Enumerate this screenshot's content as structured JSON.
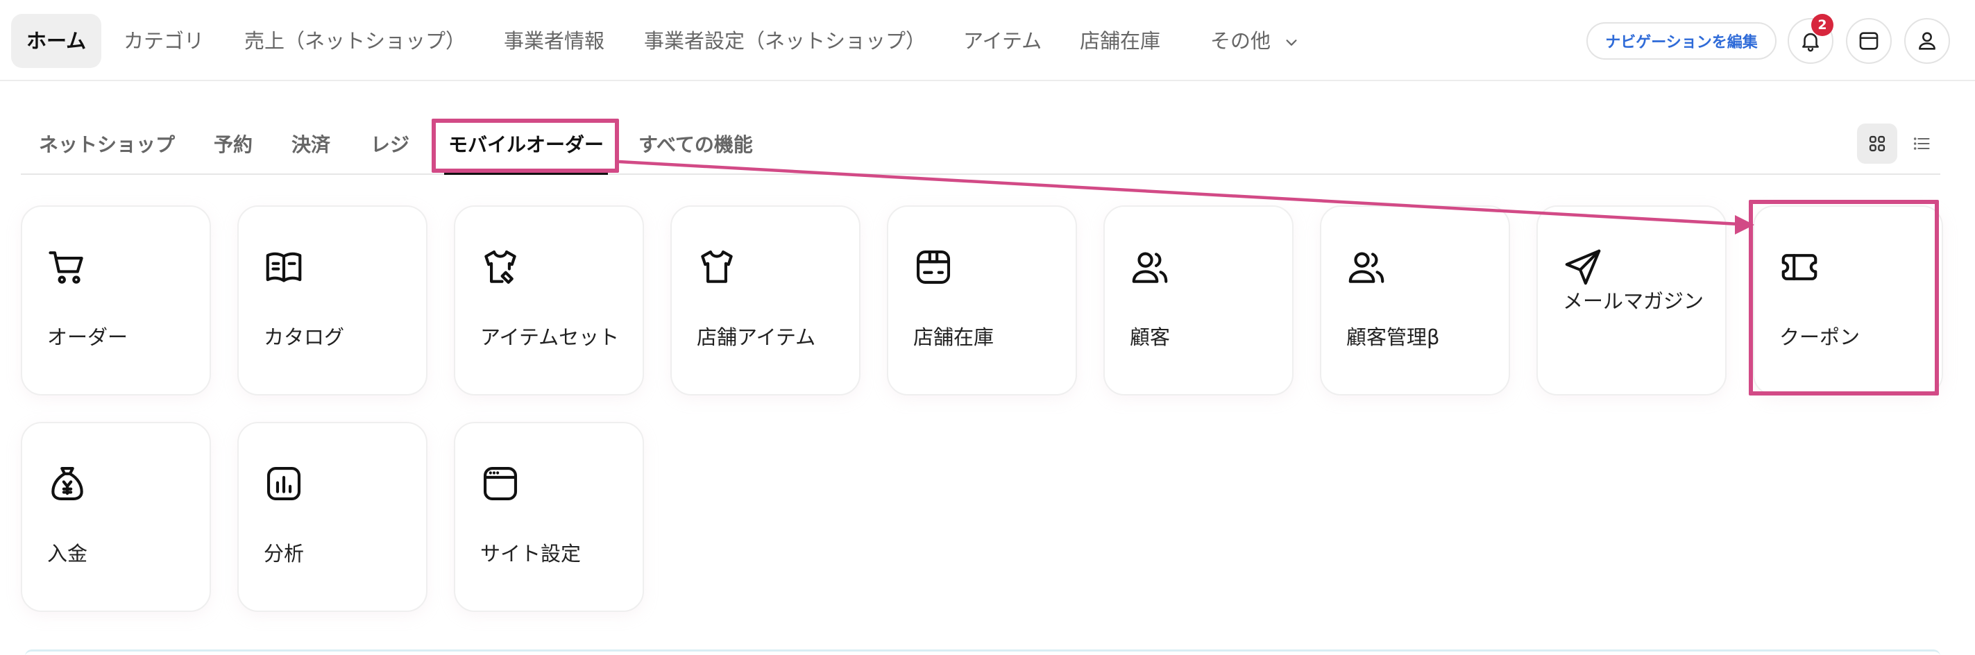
{
  "top_nav": {
    "items": [
      "ホーム",
      "カテゴリ",
      "売上（ネットショップ）",
      "事業者情報",
      "事業者設定（ネットショップ）",
      "アイテム",
      "店舗在庫",
      "その他"
    ],
    "edit_label": "ナビゲーションを編集",
    "notification_count": "2"
  },
  "sub_tabs": {
    "items": [
      "ネットショップ",
      "予約",
      "決済",
      "レジ",
      "モバイルオーダー",
      "すべての機能"
    ],
    "active": "モバイルオーダー"
  },
  "cards": [
    {
      "label": "オーダー",
      "icon": "cart-icon"
    },
    {
      "label": "カタログ",
      "icon": "catalog-book-icon"
    },
    {
      "label": "アイテムセット",
      "icon": "shirt-set-icon"
    },
    {
      "label": "店舗アイテム",
      "icon": "shirt-icon"
    },
    {
      "label": "店舗在庫",
      "icon": "inventory-box-icon"
    },
    {
      "label": "顧客",
      "icon": "users-icon"
    },
    {
      "label": "顧客管理β",
      "icon": "users-manage-icon"
    },
    {
      "label": "メールマガジン",
      "icon": "paper-plane-icon"
    },
    {
      "label": "クーポン",
      "icon": "ticket-icon"
    },
    {
      "label": "入金",
      "icon": "money-bag-icon"
    },
    {
      "label": "分析",
      "icon": "chart-icon"
    },
    {
      "label": "サイト設定",
      "icon": "browser-window-icon"
    }
  ],
  "annotation": {
    "color": "#d24a86",
    "from": "モバイルオーダー",
    "to": "クーポン"
  },
  "colors": {
    "accent_link": "#2f6bd8",
    "badge": "#d7263d"
  }
}
